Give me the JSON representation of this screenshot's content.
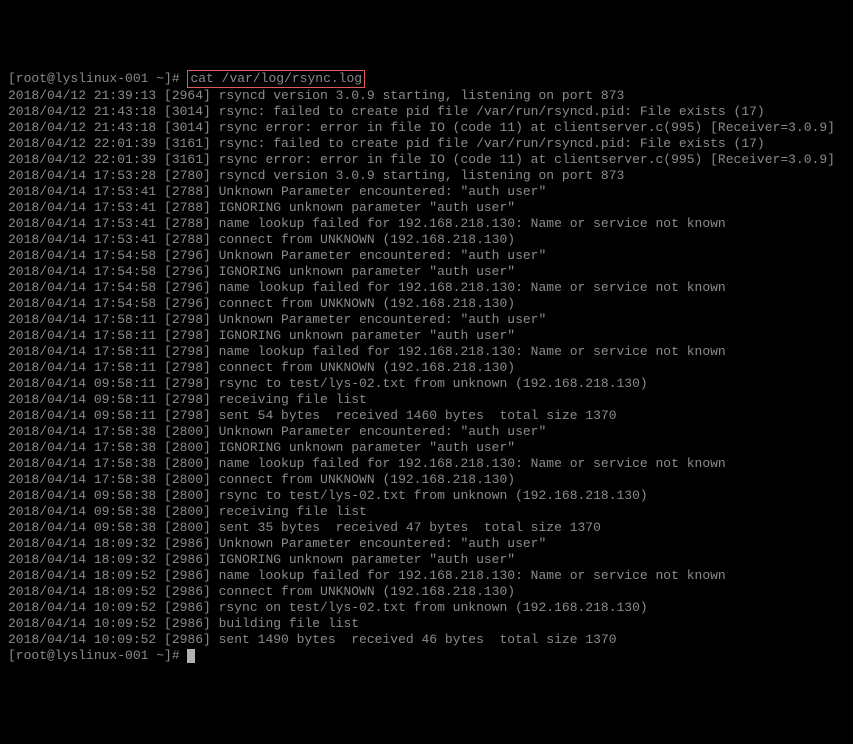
{
  "prompt1": {
    "user_host": "[root@lyslinux-001 ~]#",
    "command": "cat /var/log/rsync.log"
  },
  "lines": [
    "2018/04/12 21:39:13 [2964] rsyncd version 3.0.9 starting, listening on port 873",
    "2018/04/12 21:43:18 [3014] rsync: failed to create pid file /var/run/rsyncd.pid: File exists (17)",
    "2018/04/12 21:43:18 [3014] rsync error: error in file IO (code 11) at clientserver.c(995) [Receiver=3.0.9]",
    "2018/04/12 22:01:39 [3161] rsync: failed to create pid file /var/run/rsyncd.pid: File exists (17)",
    "2018/04/12 22:01:39 [3161] rsync error: error in file IO (code 11) at clientserver.c(995) [Receiver=3.0.9]",
    "2018/04/14 17:53:28 [2780] rsyncd version 3.0.9 starting, listening on port 873",
    "2018/04/14 17:53:41 [2788] Unknown Parameter encountered: \"auth user\"",
    "2018/04/14 17:53:41 [2788] IGNORING unknown parameter \"auth user\"",
    "2018/04/14 17:53:41 [2788] name lookup failed for 192.168.218.130: Name or service not known",
    "2018/04/14 17:53:41 [2788] connect from UNKNOWN (192.168.218.130)",
    "2018/04/14 17:54:58 [2796] Unknown Parameter encountered: \"auth user\"",
    "2018/04/14 17:54:58 [2796] IGNORING unknown parameter \"auth user\"",
    "2018/04/14 17:54:58 [2796] name lookup failed for 192.168.218.130: Name or service not known",
    "2018/04/14 17:54:58 [2796] connect from UNKNOWN (192.168.218.130)",
    "2018/04/14 17:58:11 [2798] Unknown Parameter encountered: \"auth user\"",
    "2018/04/14 17:58:11 [2798] IGNORING unknown parameter \"auth user\"",
    "2018/04/14 17:58:11 [2798] name lookup failed for 192.168.218.130: Name or service not known",
    "2018/04/14 17:58:11 [2798] connect from UNKNOWN (192.168.218.130)",
    "2018/04/14 09:58:11 [2798] rsync to test/lys-02.txt from unknown (192.168.218.130)",
    "2018/04/14 09:58:11 [2798] receiving file list",
    "2018/04/14 09:58:11 [2798] sent 54 bytes  received 1460 bytes  total size 1370",
    "2018/04/14 17:58:38 [2800] Unknown Parameter encountered: \"auth user\"",
    "2018/04/14 17:58:38 [2800] IGNORING unknown parameter \"auth user\"",
    "2018/04/14 17:58:38 [2800] name lookup failed for 192.168.218.130: Name or service not known",
    "2018/04/14 17:58:38 [2800] connect from UNKNOWN (192.168.218.130)",
    "2018/04/14 09:58:38 [2800] rsync to test/lys-02.txt from unknown (192.168.218.130)",
    "2018/04/14 09:58:38 [2800] receiving file list",
    "2018/04/14 09:58:38 [2800] sent 35 bytes  received 47 bytes  total size 1370",
    "2018/04/14 18:09:32 [2986] Unknown Parameter encountered: \"auth user\"",
    "2018/04/14 18:09:32 [2986] IGNORING unknown parameter \"auth user\"",
    "2018/04/14 18:09:52 [2986] name lookup failed for 192.168.218.130: Name or service not known",
    "2018/04/14 18:09:52 [2986] connect from UNKNOWN (192.168.218.130)",
    "2018/04/14 10:09:52 [2986] rsync on test/lys-02.txt from unknown (192.168.218.130)",
    "2018/04/14 10:09:52 [2986] building file list",
    "2018/04/14 10:09:52 [2986] sent 1490 bytes  received 46 bytes  total size 1370"
  ],
  "prompt2": {
    "user_host": "[root@lyslinux-001 ~]#"
  }
}
